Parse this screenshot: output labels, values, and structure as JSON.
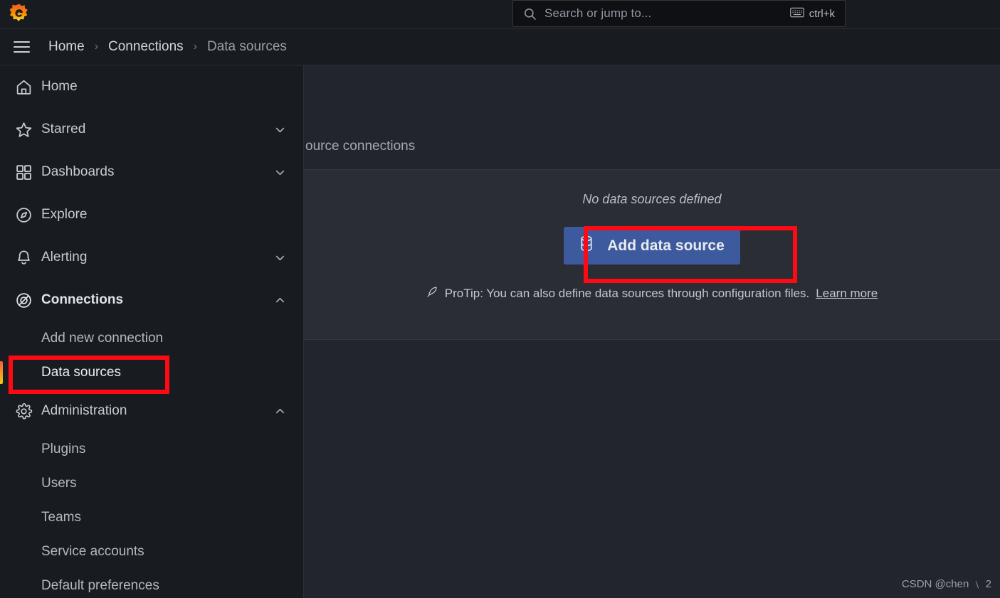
{
  "topbar": {
    "logo_icon": "grafana-logo-icon",
    "search": {
      "icon": "search-icon",
      "placeholder": "Search or jump to...",
      "value": "",
      "kbd_icon": "keyboard-icon",
      "shortcut": "ctrl+k"
    }
  },
  "breadcrumb": {
    "menu_icon": "hamburger-menu-icon",
    "separator": "›",
    "items": [
      {
        "label": "Home"
      },
      {
        "label": "Connections"
      },
      {
        "label": "Data sources"
      }
    ]
  },
  "sidebar": {
    "items": [
      {
        "label": "Home",
        "icon": "home-icon",
        "type": "item",
        "expandable": false
      },
      {
        "label": "Starred",
        "icon": "star-icon",
        "type": "item",
        "expandable": true,
        "chevron": "chevron-down-icon"
      },
      {
        "label": "Dashboards",
        "icon": "dashboards-icon",
        "type": "item",
        "expandable": true,
        "chevron": "chevron-down-icon"
      },
      {
        "label": "Explore",
        "icon": "compass-icon",
        "type": "item",
        "expandable": false
      },
      {
        "label": "Alerting",
        "icon": "bell-icon",
        "type": "item",
        "expandable": true,
        "chevron": "chevron-down-icon"
      },
      {
        "label": "Connections",
        "icon": "connections-icon",
        "type": "item",
        "expandable": true,
        "chevron": "chevron-up-icon",
        "bold": true
      },
      {
        "label": "Add new connection",
        "type": "sub",
        "active": false
      },
      {
        "label": "Data sources",
        "type": "sub",
        "active": true
      },
      {
        "label": "Administration",
        "icon": "gear-icon",
        "type": "item",
        "expandable": true,
        "chevron": "chevron-up-icon"
      },
      {
        "label": "Plugins",
        "type": "sub",
        "active": false
      },
      {
        "label": "Users",
        "type": "sub",
        "active": false
      },
      {
        "label": "Teams",
        "type": "sub",
        "active": false
      },
      {
        "label": "Service accounts",
        "type": "sub",
        "active": false
      },
      {
        "label": "Default preferences",
        "type": "sub",
        "active": false
      }
    ]
  },
  "main": {
    "page_subtitle": "ource connections",
    "empty_state": {
      "title": "No data sources defined",
      "button": {
        "label": "Add data source",
        "icon": "database-icon"
      },
      "protip": {
        "icon": "protip-rocket-icon",
        "text": "ProTip: You can also define data sources through configuration files.",
        "link_label": "Learn more"
      }
    }
  },
  "annotations": {
    "color": "#ff0a14",
    "highlight_sidebar_item": "Data sources",
    "highlight_button": "Add data source"
  },
  "watermark": {
    "text": "CSDN @chen ﹨ 2"
  },
  "colors": {
    "chrome_bg": "#181b1f",
    "content_bg": "#22252b",
    "card_bg": "#2a2d33",
    "primary_button": "#3d5a9e",
    "accent_gradient_start": "#f55f3e",
    "accent_gradient_end": "#f2cc0c",
    "annotation_red": "#ff0a14"
  }
}
